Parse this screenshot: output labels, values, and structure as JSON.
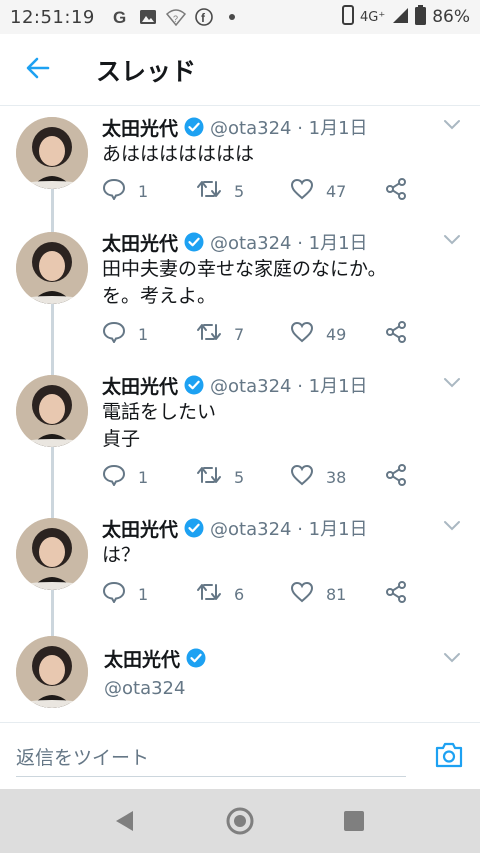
{
  "status_bar": {
    "time": "12:51:19",
    "icons": [
      "google-icon",
      "image-icon",
      "wifi-question-icon",
      "facebook-icon",
      "dot-icon"
    ],
    "right_icons": [
      "phone-icon",
      "signal-4g-icon",
      "battery-icon"
    ],
    "network": "4G⁺",
    "battery": "86%"
  },
  "header": {
    "back_icon": "arrow-left-icon",
    "title": "スレッド"
  },
  "colors": {
    "accent": "#1da1f2",
    "text": "#14171a",
    "muted": "#657786",
    "border": "#e6ecf0",
    "navbar": "#dddddd"
  },
  "tweets": [
    {
      "name": "太田光代",
      "handle": "@ota324 · 1月1日",
      "text_lines": [
        "あははははははは"
      ],
      "replies": "1",
      "retweets": "5",
      "likes": "47"
    },
    {
      "name": "太田光代",
      "handle": "@ota324 · 1月1日",
      "text_lines": [
        "田中夫妻の幸せな家庭のなにか。",
        "を。考えよ。"
      ],
      "replies": "1",
      "retweets": "7",
      "likes": "49"
    },
    {
      "name": "太田光代",
      "handle": "@ota324 · 1月1日",
      "text_lines": [
        "電話をしたい",
        "貞子"
      ],
      "replies": "1",
      "retweets": "5",
      "likes": "38"
    },
    {
      "name": "太田光代",
      "handle": "@ota324 · 1月1日",
      "text_lines": [
        "は？"
      ],
      "replies": "1",
      "retweets": "6",
      "likes": "81"
    }
  ],
  "main_tweet": {
    "name": "太田光代",
    "handle": "@ota324"
  },
  "reply_bar": {
    "placeholder": "返信をツイート",
    "camera_icon": "camera-icon"
  },
  "nav_bar": {
    "icons": [
      "back-triangle-icon",
      "home-circle-icon",
      "recents-square-icon"
    ]
  }
}
